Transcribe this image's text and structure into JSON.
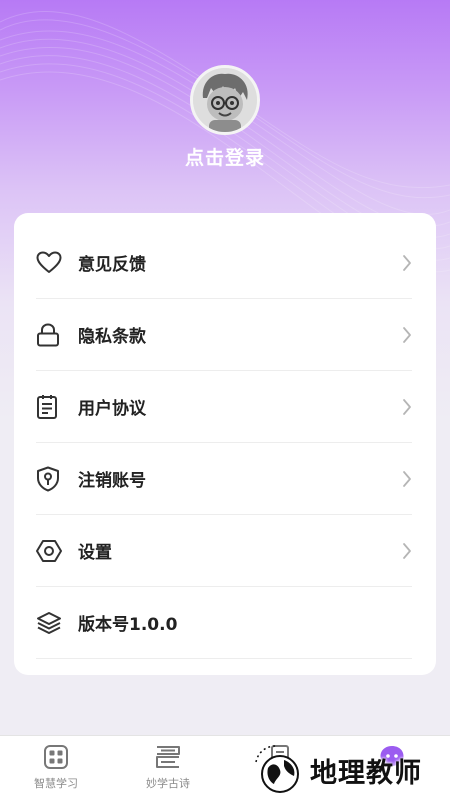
{
  "profile": {
    "login_text": "点击登录"
  },
  "menu": [
    {
      "label": "意见反馈",
      "icon": "heart-icon",
      "has_arrow": true
    },
    {
      "label": "隐私条款",
      "icon": "lock-icon",
      "has_arrow": true
    },
    {
      "label": "用户协议",
      "icon": "document-icon",
      "has_arrow": true
    },
    {
      "label": "注销账号",
      "icon": "shield-key-icon",
      "has_arrow": true
    },
    {
      "label": "设置",
      "icon": "hexagon-settings-icon",
      "has_arrow": true
    },
    {
      "label": "版本号1.0.0",
      "icon": "layers-icon",
      "has_arrow": false
    }
  ],
  "tabbar": {
    "tabs": [
      {
        "label": "智慧学习",
        "icon": "grid-icon"
      },
      {
        "label": "妙学古诗",
        "icon": "book-icon"
      },
      {
        "label": "",
        "icon": "document-icon"
      },
      {
        "label": "",
        "icon": "chat-icon"
      }
    ],
    "active_color": "#9b5cf0"
  },
  "watermark": {
    "text": "地理教师"
  }
}
